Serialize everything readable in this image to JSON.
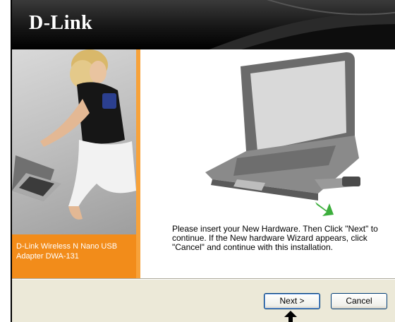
{
  "window": {
    "logo": "D-Link"
  },
  "sidebar": {
    "product_label": "D-Link Wireless N Nano USB Adapter DWA-131"
  },
  "main": {
    "instructions": "Please insert your New Hardware. Then Click \"Next\" to continue. If the New hardware Wizard appears, click \"Cancel\" and continue with this installation."
  },
  "buttons": {
    "next": "Next >",
    "cancel": "Cancel"
  },
  "colors": {
    "banner": "#161616",
    "sidebar_orange": "#f28c1a",
    "dialog_bg": "#ece9d8",
    "arrow_green": "#3cae3c"
  }
}
